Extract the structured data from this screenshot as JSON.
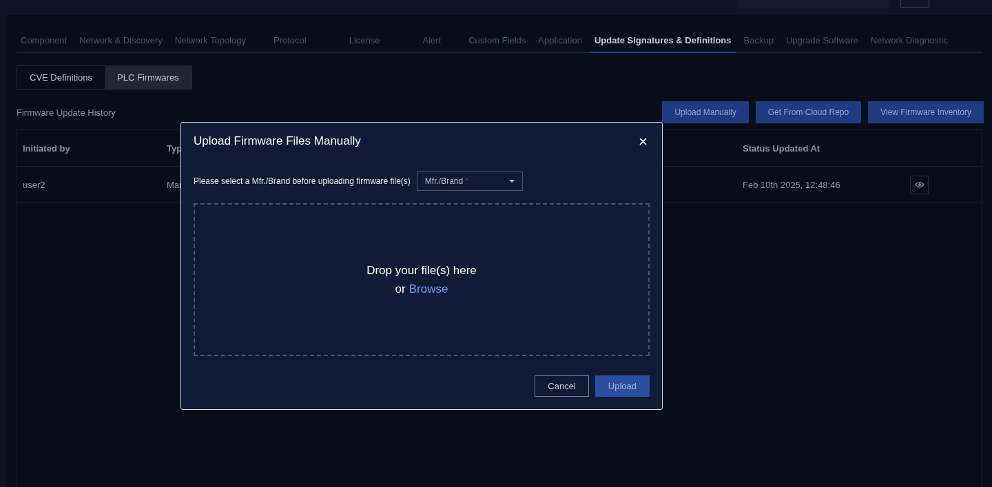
{
  "tabs": [
    {
      "label": "Component",
      "selected": false
    },
    {
      "label": "Network & Discovery",
      "selected": false
    },
    {
      "label": "Network Topology",
      "selected": false
    },
    {
      "label": "Protocol",
      "selected": false
    },
    {
      "label": "License",
      "selected": false
    },
    {
      "label": "Alert",
      "selected": false
    },
    {
      "label": "Custom Fields",
      "selected": false
    },
    {
      "label": "Application",
      "selected": false
    },
    {
      "label": "Update Signatures & Definitions",
      "selected": true
    },
    {
      "label": "Backup",
      "selected": false
    },
    {
      "label": "Upgrade Software",
      "selected": false
    },
    {
      "label": "Network Diagnostic",
      "selected": false
    }
  ],
  "subtabs": [
    {
      "label": "CVE Definitions",
      "selected": false
    },
    {
      "label": "PLC Firmwares",
      "selected": true
    }
  ],
  "section_title": "Firmware Update History",
  "actions": [
    "Upload Manually",
    "Get From Cloud Repo",
    "View Firmware Inventory"
  ],
  "table": {
    "columns": [
      "Initiated by",
      "Typ",
      "Status Updated At"
    ],
    "rows": [
      {
        "cells": [
          "user2",
          "Mar",
          "Feb 10th 2025, 12:48:46"
        ]
      }
    ]
  },
  "dialog": {
    "title": "Upload Firmware Files Manually",
    "prompt": "Please select a Mfr./Brand before uploading firmware file(s)",
    "select": {
      "placeholder": "Mfr./Brand",
      "required_mark": "*"
    },
    "drop_text": "Drop your file(s) here",
    "or_text": "or",
    "browse_link": "Browse",
    "buttons": [
      {
        "label": "Cancel",
        "kind": "secondary"
      },
      {
        "label": "Upload",
        "kind": "primary"
      }
    ]
  }
}
